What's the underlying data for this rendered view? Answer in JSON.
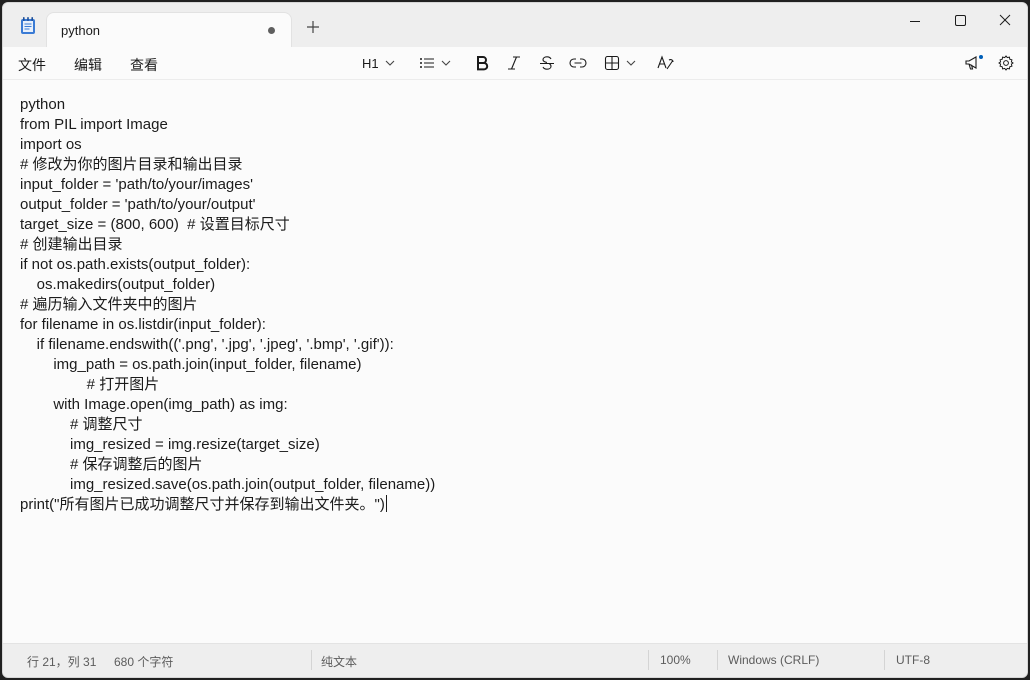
{
  "tab": {
    "title": "python",
    "unsaved": true
  },
  "menu": {
    "file": "文件",
    "edit": "编辑",
    "view": "查看"
  },
  "toolbar": {
    "heading": "H1"
  },
  "editor": {
    "lines": [
      "python",
      "from PIL import Image",
      "import os",
      "# 修改为你的图片目录和输出目录",
      "input_folder = 'path/to/your/images'",
      "output_folder = 'path/to/your/output'",
      "target_size = (800, 600)  # 设置目标尺寸",
      "# 创建输出目录",
      "if not os.path.exists(output_folder):",
      "    os.makedirs(output_folder)",
      "# 遍历输入文件夹中的图片",
      "for filename in os.listdir(input_folder):",
      "    if filename.endswith(('.png', '.jpg', '.jpeg', '.bmp', '.gif')):",
      "        img_path = os.path.join(input_folder, filename)",
      "                # 打开图片",
      "        with Image.open(img_path) as img:",
      "            # 调整尺寸",
      "            img_resized = img.resize(target_size)",
      "            # 保存调整后的图片",
      "            img_resized.save(os.path.join(output_folder, filename))",
      "print(\"所有图片已成功调整尺寸并保存到输出文件夹。\")"
    ]
  },
  "status": {
    "position": "行 21，列 31",
    "char_count": "680 个字符",
    "format": "纯文本",
    "zoom": "100%",
    "line_ending": "Windows (CRLF)",
    "encoding": "UTF-8"
  },
  "colors": {
    "accent": "#005fb8",
    "notify_dot": "#005fb8"
  }
}
